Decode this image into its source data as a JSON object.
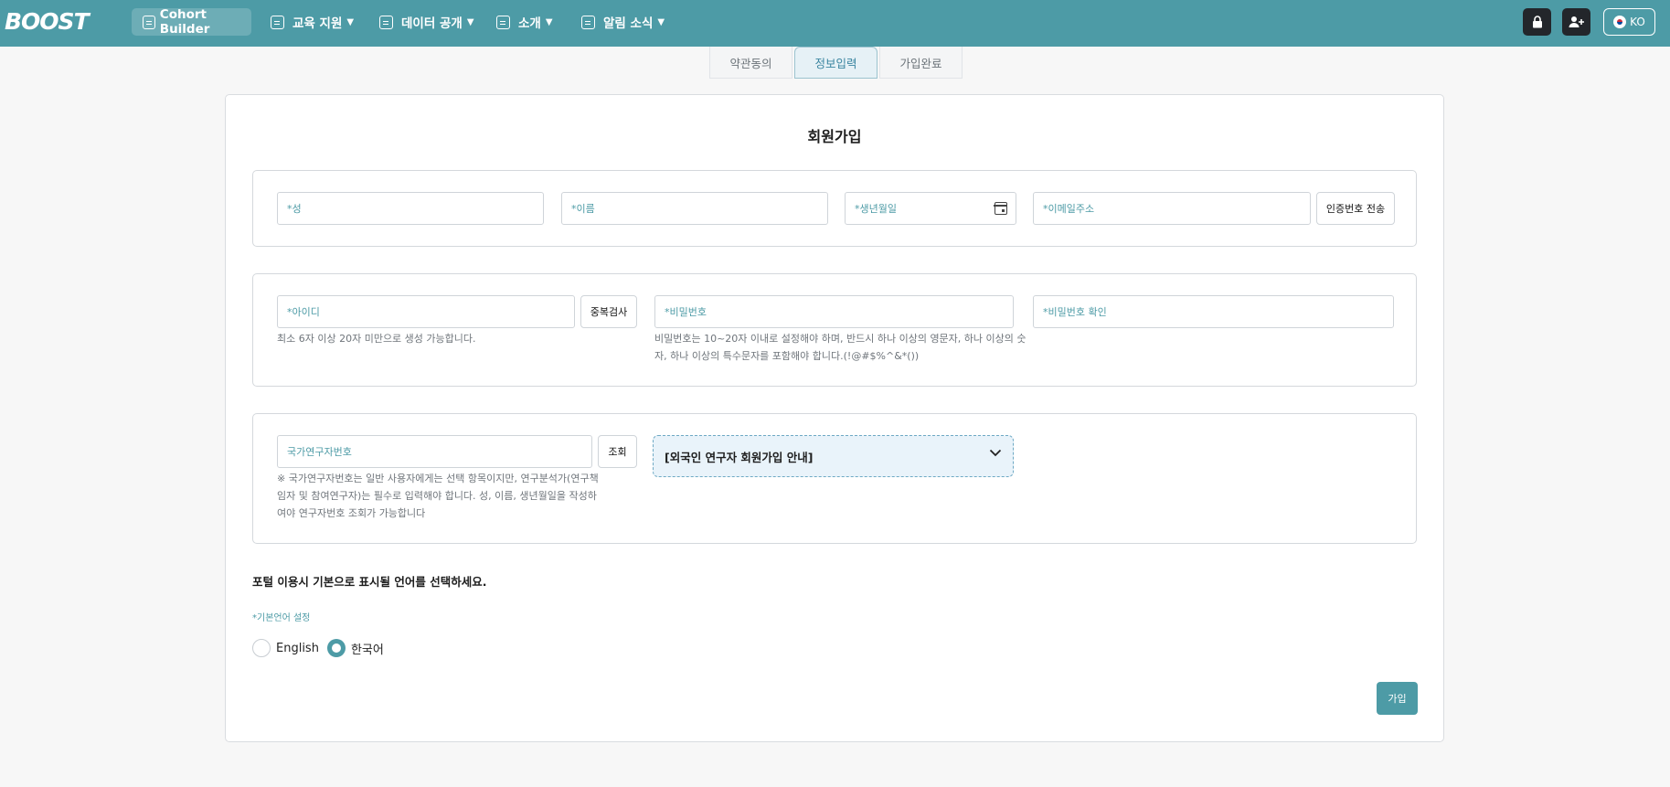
{
  "nav": {
    "logo": "BOOST",
    "cohort_label": "Cohort Builder",
    "menus": [
      {
        "label": "교육 지원"
      },
      {
        "label": "데이터 공개"
      },
      {
        "label": "소개"
      },
      {
        "label": "알림 소식"
      }
    ],
    "lang_code": "KO",
    "icons": [
      "lock-icon",
      "add-user-icon",
      "korea-flag-icon"
    ]
  },
  "steps": [
    {
      "label": "약관동의",
      "active": false
    },
    {
      "label": "정보입력",
      "active": true
    },
    {
      "label": "가입완료",
      "active": false
    }
  ],
  "form": {
    "title": "회원가입",
    "last_name_placeholder": "*성",
    "first_name_placeholder": "*이름",
    "birth_placeholder": "*생년월일",
    "email_placeholder": "*이메일주소",
    "send_code_label": "인증번호 전송",
    "id_placeholder": "*아이디",
    "dup_check_label": "중복검사",
    "id_hint": "최소 6자 이상 20자 미만으로 생성 가능합니다.",
    "password_placeholder": "*비밀번호",
    "password_hint_line1": "비밀번호는 10~20자 이내로 설정해야 하며, 반드시 하나 이상의 영문자, 하나 이상의 숫",
    "password_hint_line2": "자, 하나 이상의 특수문자를 포함해야 합니다.(!@#$%^&*())",
    "password_confirm_placeholder": "*비밀번호 확인",
    "researcher_id_placeholder": "국가연구자번호",
    "lookup_label": "조회",
    "researcher_hint_line1": "※ 국가연구자번호는 일반 사용자에게는 선택 항목이지만, 연구분석가(연구책",
    "researcher_hint_line2": "임자 및 참여연구자)는 필수로 입력해야 합니다. 성, 이름, 생년월일을 작성하",
    "researcher_hint_line3": "여야 연구자번호 조회가 가능합니다",
    "foreign_guide_label": "[외국인 연구자 회원가입 안내]",
    "language_question": "포털 이용시 기본으로 표시될 언어를 선택하세요.",
    "language_setting_label": "*기본언어 설정",
    "language_options": [
      {
        "label": "English",
        "selected": false
      },
      {
        "label": "한국어",
        "selected": true
      }
    ],
    "submit_label": "가입"
  },
  "colors": {
    "nav_bg": "#4d9ba6",
    "accent": "#4d9ba6",
    "active_tab_bg": "#e6f1f6",
    "dark_button": "#23262b"
  }
}
